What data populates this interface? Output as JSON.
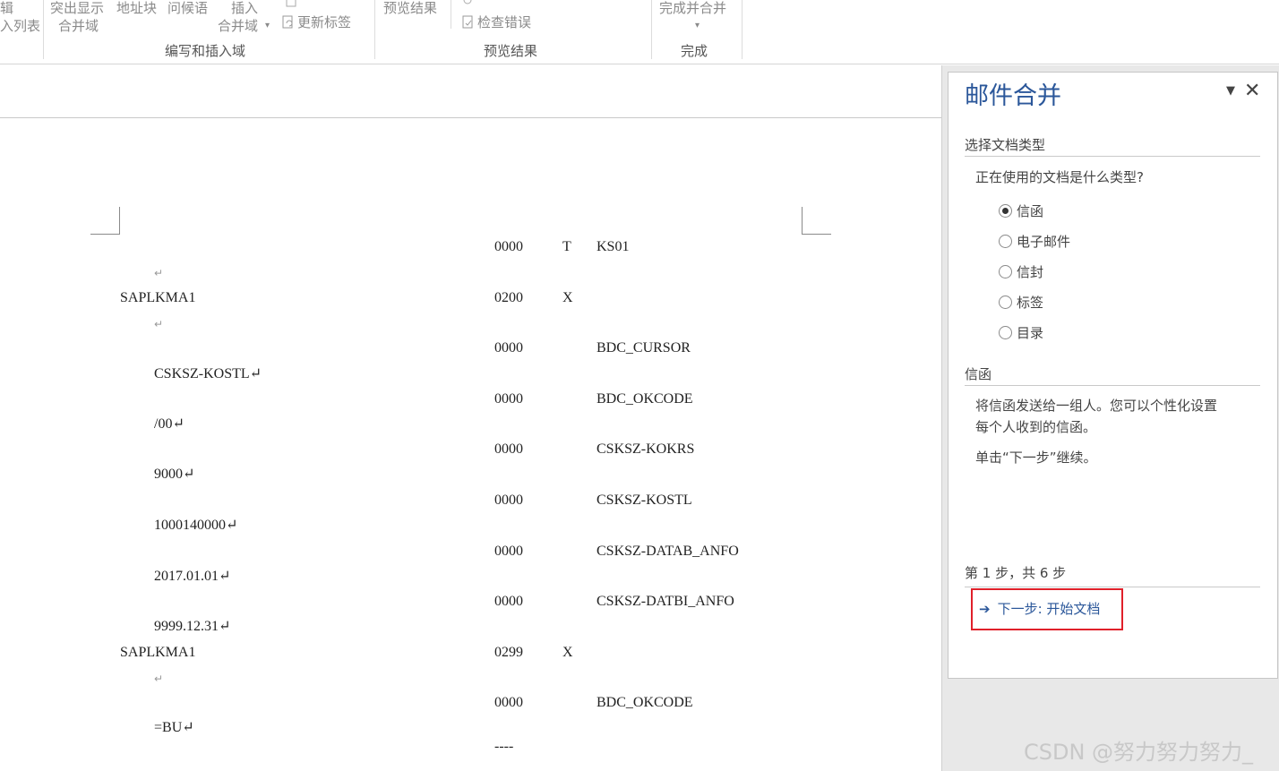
{
  "ribbon": {
    "frag_top_left": "辑",
    "frag_list": "入列表",
    "highlight_merge": "突出显示",
    "highlight_merge_2": "合并域",
    "address_block": "地址块",
    "greeting": "问候语",
    "insert_merge": "插入",
    "insert_merge_2": "合并域",
    "update_labels": "更新标签",
    "preview_results": "预览结果",
    "check_errors": "检查错误",
    "finish_merge": "完成并合并",
    "group_write_insert": "编写和插入域",
    "group_preview": "预览结果",
    "group_finish": "完成"
  },
  "document": {
    "left_col": [
      {
        "text": "↵"
      },
      {
        "text": "SAPLKMA1"
      },
      {
        "text": "↵"
      },
      {
        "text": "CSKSZ-KOSTL↵"
      },
      {
        "text": "/00↵"
      },
      {
        "text": "9000↵"
      },
      {
        "text": "1000140000↵"
      },
      {
        "text": "2017.01.01↵"
      },
      {
        "text": "9999.12.31↵"
      },
      {
        "text": "SAPLKMA1"
      },
      {
        "text": "↵"
      },
      {
        "text": "=BU↵"
      }
    ],
    "rows": [
      {
        "num": "0000",
        "flag": "T",
        "field": "KS01"
      },
      {
        "num": "0200",
        "flag": "X",
        "field": ""
      },
      {
        "num": "0000",
        "flag": "",
        "field": "BDC_CURSOR"
      },
      {
        "num": "0000",
        "flag": "",
        "field": "BDC_OKCODE"
      },
      {
        "num": "0000",
        "flag": "",
        "field": "CSKSZ-KOKRS"
      },
      {
        "num": "0000",
        "flag": "",
        "field": "CSKSZ-KOSTL"
      },
      {
        "num": "0000",
        "flag": "",
        "field": "CSKSZ-DATAB_ANFO"
      },
      {
        "num": "0000",
        "flag": "",
        "field": "CSKSZ-DATBI_ANFO"
      },
      {
        "num": "0299",
        "flag": "X",
        "field": ""
      },
      {
        "num": "0000",
        "flag": "",
        "field": "BDC_OKCODE"
      },
      {
        "num": "----",
        "flag": "",
        "field": ""
      }
    ]
  },
  "pane": {
    "title": "邮件合并",
    "menu_icon": "▼",
    "close_icon": "✕",
    "section_doc_type": "选择文档类型",
    "question": "正在使用的文档是什么类型?",
    "options": [
      {
        "label": "信函",
        "selected": true
      },
      {
        "label": "电子邮件",
        "selected": false
      },
      {
        "label": "信封",
        "selected": false
      },
      {
        "label": "标签",
        "selected": false
      },
      {
        "label": "目录",
        "selected": false
      }
    ],
    "section_letter": "信函",
    "desc_line1": "将信函发送给一组人。您可以个性化设置",
    "desc_line2": "每个人收到的信函。",
    "continue_hint": "单击“下一步”继续。",
    "step_text": "第 1 步，共 6 步",
    "next_arrow": "➔",
    "next_link": "下一步: 开始文档",
    "highlight_color": "#e0202a",
    "accent_color": "#2b579a"
  },
  "watermark": "CSDN @努力努力努力_"
}
